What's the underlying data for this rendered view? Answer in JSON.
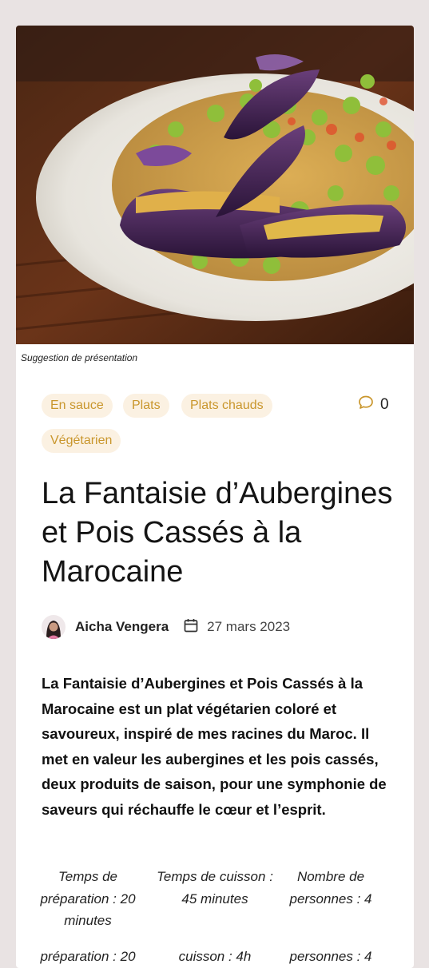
{
  "hero": {
    "caption": "Suggestion de présentation"
  },
  "tags": [
    "En sauce",
    "Plats",
    "Plats chauds",
    "Végétarien"
  ],
  "comments": {
    "count": "0"
  },
  "article": {
    "title": "La Fantaisie d’Aubergines et Pois Cassés à la Marocaine",
    "author": "Aicha Vengera",
    "date": "27 mars 2023",
    "intro": "La Fantaisie d’Aubergines et Pois Cassés à la Marocaine est un plat végétarien coloré et savoureux, inspiré de mes racines du Maroc. Il met en valeur les aubergines et les pois cassés, deux produits de saison, pour une symphonie de saveurs qui réchauffe le cœur et l’esprit."
  },
  "recipe_info": [
    {
      "text": "Temps de préparation : 20 minutes"
    },
    {
      "text": "Temps de cuisson : 45 minutes"
    },
    {
      "text": "Nombre de personnes : 4"
    }
  ],
  "recipe_info_cut": [
    {
      "text": "préparation : 20"
    },
    {
      "text": "cuisson : 4h"
    },
    {
      "text": "personnes : 4"
    }
  ],
  "colors": {
    "tag_bg": "#fbf1e2",
    "tag_text": "#c9962c",
    "page_bg": "#e9e3e3"
  }
}
